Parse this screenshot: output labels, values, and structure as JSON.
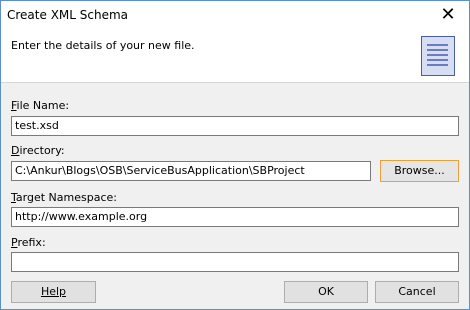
{
  "window": {
    "title": "Create XML Schema",
    "close_glyph": "✕"
  },
  "header": {
    "text": "Enter the details of your new file.",
    "icon": "document-lines-icon"
  },
  "fields": {
    "file_name": {
      "label_key": "F",
      "label_rest": "ile Name:",
      "value": "test.xsd"
    },
    "directory": {
      "label_key": "D",
      "label_rest": "irectory:",
      "value": "C:\\Ankur\\Blogs\\OSB\\ServiceBusApplication\\SBProject"
    },
    "target_namespace": {
      "label_key": "T",
      "label_rest": "arget Namespace:",
      "value": "http://www.example.org"
    },
    "prefix": {
      "label_key": "P",
      "label_rest": "refix:",
      "value": ""
    }
  },
  "buttons": {
    "browse": "Browse...",
    "help": "Help",
    "ok": "OK",
    "cancel": "Cancel"
  }
}
